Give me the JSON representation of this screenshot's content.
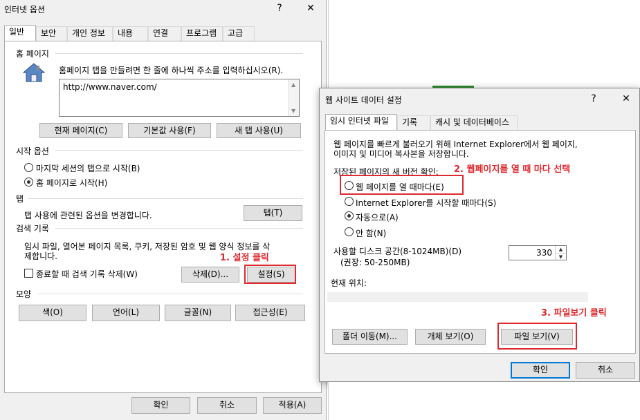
{
  "main_dialog": {
    "title": "인터넷 옵션",
    "title_buttons": {
      "help": "?",
      "close": "✕"
    },
    "tabs": [
      "일반",
      "보안",
      "개인 정보",
      "내용",
      "연결",
      "프로그램",
      "고급"
    ],
    "home_page": {
      "label": "홈 페이지",
      "description": "홈페이지 탭을 만들려면 한 줄에 하나씩 주소를 입력하십시오(R).",
      "url": "http://www.naver.com/",
      "buttons": [
        "현재 페이지(C)",
        "기본값 사용(F)",
        "새 탭 사용(U)"
      ]
    },
    "startup": {
      "label": "시작 옵션",
      "options": [
        "마지막 세션의 탭으로 시작(B)",
        "홈 페이지로 시작(H)"
      ],
      "selected": "홈 페이지로 시작(H)"
    },
    "tabs_section": {
      "label": "탭",
      "description": "탭 사용에 관련된 옵션을 변경합니다.",
      "button": "탭(T)"
    },
    "history": {
      "label": "검색 기록",
      "description_line1": "임시 파일, 열어본 페이지 목록, 쿠키, 저장된 암호 및 웹 양식 정보를 삭",
      "description_line2": "제합니다.",
      "checkbox_label": "종료할 때 검색 기록 삭제(W)",
      "delete_button": "삭제(D)...",
      "settings_button": "설정(S)"
    },
    "appearance": {
      "label": "모양",
      "buttons": [
        "색(O)",
        "언어(L)",
        "글꼴(N)",
        "접근성(E)"
      ]
    },
    "footer_buttons": [
      "확인",
      "취소",
      "적용(A)"
    ]
  },
  "settings_dialog": {
    "title": "웹 사이트 데이터 설정",
    "title_buttons": {
      "help": "?",
      "close": "✕"
    },
    "tabs": [
      "임시 인터넷 파일",
      "기록",
      "캐시 및 데이터베이스"
    ],
    "description_line1": "웹 페이지를 빠르게 불러오기 위해 Internet Explorer에서 웹 페이지,",
    "description_line2": "이미지 및 미디어 복사본을 저장합니다.",
    "check_label": "저장된 페이지의 새 버전 확인:",
    "check_options": [
      "웹 페이지를 열 때마다(E)",
      "Internet Explorer를 시작할 때마다(S)",
      "자동으로(A)",
      "안 함(N)"
    ],
    "check_selected": "자동으로(A)",
    "disk_label": "사용할 디스크 공간(8-1024MB)(D)",
    "disk_recommend": "(권장: 50-250MB)",
    "disk_value": "330",
    "location_label": "현재 위치:",
    "location_value": "",
    "buttons": [
      "폴더 이동(M)...",
      "개체 보기(O)",
      "파일 보기(V)"
    ],
    "footer_buttons": [
      "확인",
      "취소"
    ]
  },
  "annotations": [
    "1. 설정 클릭",
    "2. 웹페이지를 열 때 마다 선택",
    "3. 파일보기 클릭"
  ],
  "colors": {
    "accent": "#0078d7",
    "annotation": "#e0282e",
    "green": "#2e8b2e"
  }
}
